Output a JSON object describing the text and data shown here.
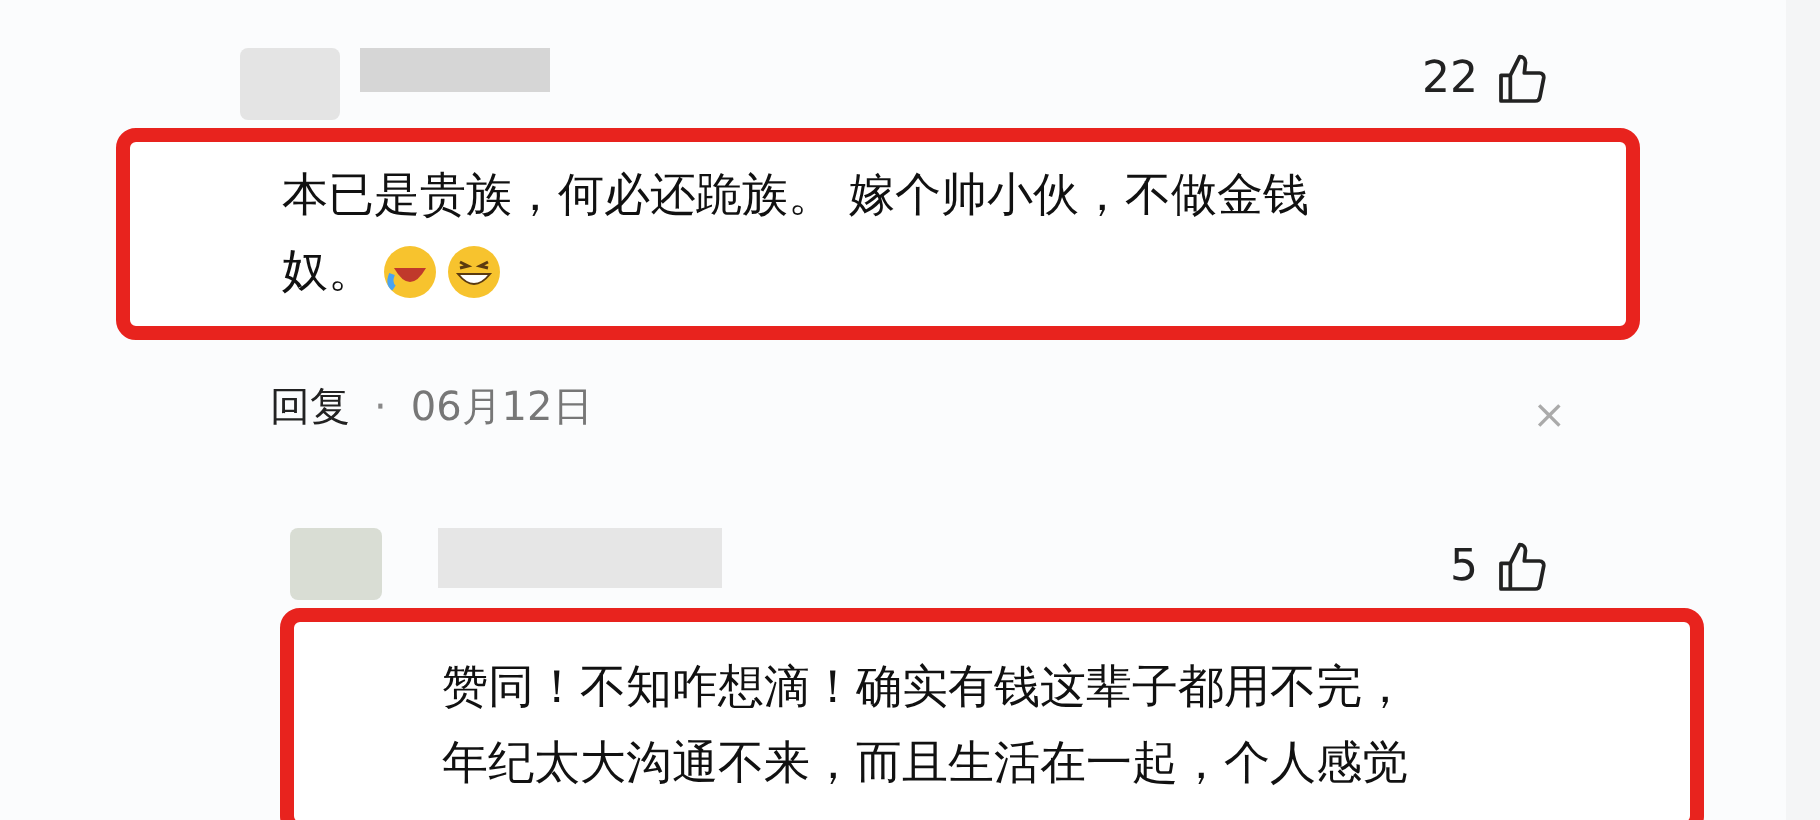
{
  "comments": [
    {
      "likes": "22",
      "lines": [
        "本已是贵族，何必还跪族。 嫁个帅小伙，不做金钱",
        "奴。"
      ],
      "emojis": [
        {
          "kind": "laughing"
        },
        {
          "kind": "grinning"
        }
      ],
      "reply": "回复",
      "separator": "·",
      "date": "06月12日",
      "close": "×"
    },
    {
      "likes": "5",
      "lines": [
        "赞同！不知咋想滴！确实有钱这辈子都用不完，",
        "年纪太大沟通不来，而且生活在一起，个人感觉"
      ]
    }
  ]
}
